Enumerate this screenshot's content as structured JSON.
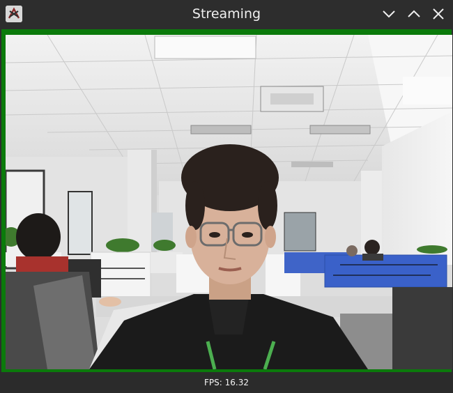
{
  "window": {
    "title": "Streaming",
    "icons": {
      "app": "app-logo-icon",
      "minimize": "chevron-down-icon",
      "maximize": "chevron-up-icon",
      "close": "close-icon"
    }
  },
  "stream": {
    "frame_color": "#0b7a0b",
    "fps_text": "FPS: 16.32"
  }
}
